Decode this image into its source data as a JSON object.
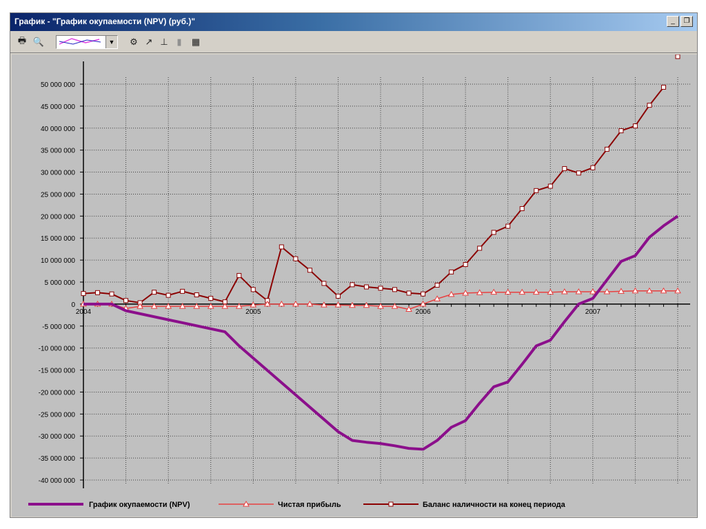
{
  "window": {
    "title": "График - \"График окупаемости (NPV) (руб.)\""
  },
  "toolbar": {
    "icons": [
      "printer-icon",
      "print-preview-icon",
      "chart-type-combo",
      "chart-properties-icon",
      "axis-icon",
      "gridlines-icon",
      "3d-icon",
      "table-icon"
    ]
  },
  "colors": {
    "npv": "#8b0f8b",
    "profit": "#e84040",
    "balance": "#8b0000",
    "plot_background": "#c0c0c0"
  },
  "chart_data": {
    "type": "line",
    "title": "",
    "xlabel": "",
    "ylabel": "",
    "ylim": [
      -40000000,
      50000000
    ],
    "ytick_values": [
      50000000,
      45000000,
      40000000,
      35000000,
      30000000,
      25000000,
      20000000,
      15000000,
      10000000,
      5000000,
      0,
      -5000000,
      -10000000,
      -15000000,
      -20000000,
      -25000000,
      -30000000,
      -35000000,
      -40000000
    ],
    "ytick_labels": [
      "50 000 000",
      "45 000 000",
      "40 000 000",
      "35 000 000",
      "30 000 000",
      "25 000 000",
      "20 000 000",
      "15 000 000",
      "10 000 000",
      "5 000 000",
      "0",
      "-5 000 000",
      "-10 000 000",
      "-15 000 000",
      "-20 000 000",
      "-25 000 000",
      "-30 000 000",
      "-35 000 000",
      "-40 000 000"
    ],
    "x_period_months": 42,
    "year_labels": [
      {
        "label": "2004",
        "month": 0
      },
      {
        "label": "2005",
        "month": 12
      },
      {
        "label": "2006",
        "month": 24
      },
      {
        "label": "2007",
        "month": 36
      }
    ],
    "grid": true,
    "legend_position": "bottom",
    "series": [
      {
        "name": "График окупаемости (NPV)",
        "marker": "none",
        "months": [
          0,
          1,
          2,
          3,
          10,
          11,
          12,
          18,
          19,
          20,
          21,
          22,
          23,
          24,
          25,
          26,
          27,
          28,
          29,
          30,
          31,
          32,
          33,
          34,
          35,
          36,
          37,
          38,
          39,
          40,
          41,
          42
        ],
        "values": [
          0,
          0,
          0,
          -1500000,
          -6300000,
          -9500000,
          -12300000,
          -29000000,
          -31000000,
          -31400000,
          -31700000,
          -32200000,
          -32800000,
          -33000000,
          -31000000,
          -28000000,
          -26500000,
          -22500000,
          -18800000,
          -17700000,
          -13700000,
          -9500000,
          -8200000,
          -4000000,
          0,
          1300000,
          5500000,
          9700000,
          11000000,
          15200000,
          17800000,
          20000000
        ]
      },
      {
        "name": "Чистая прибыль",
        "marker": "triangle",
        "months": [
          0,
          1,
          2,
          3,
          4,
          5,
          6,
          7,
          8,
          9,
          10,
          11,
          12,
          13,
          14,
          15,
          16,
          17,
          18,
          19,
          20,
          21,
          22,
          23,
          24,
          25,
          26,
          27,
          28,
          29,
          30,
          31,
          32,
          33,
          34,
          35,
          36,
          37,
          38,
          39,
          40,
          41,
          42
        ],
        "values": [
          0,
          0,
          0,
          -1000000,
          -500000,
          -500000,
          -500000,
          -500000,
          -500000,
          -500000,
          -500000,
          -500000,
          -200000,
          0,
          0,
          0,
          0,
          -200000,
          -200000,
          -300000,
          -300000,
          -500000,
          -500000,
          -1200000,
          0,
          1200000,
          2200000,
          2500000,
          2600000,
          2700000,
          2700000,
          2700000,
          2700000,
          2700000,
          2800000,
          2800000,
          2800000,
          2800000,
          2900000,
          3000000,
          3000000,
          3000000,
          3000000
        ]
      },
      {
        "name": "Баланс наличности на конец периода",
        "marker": "square",
        "months": [
          0,
          1,
          2,
          3,
          4,
          5,
          6,
          7,
          8,
          9,
          10,
          11,
          12,
          13,
          14,
          15,
          16,
          17,
          18,
          19,
          20,
          21,
          22,
          23,
          24,
          25,
          26,
          27,
          28,
          29,
          30,
          31,
          32,
          33,
          34,
          35,
          36,
          37,
          38,
          39,
          40,
          41,
          42
        ],
        "values": [
          2400000,
          2600000,
          2300000,
          800000,
          300000,
          2700000,
          2000000,
          2900000,
          2100000,
          1300000,
          500000,
          6500000,
          3300000,
          800000,
          13000000,
          10300000,
          7700000,
          4700000,
          1800000,
          4400000,
          3900000,
          3600000,
          3300000,
          2500000,
          2300000,
          4300000,
          7300000,
          9000000,
          12700000,
          16300000,
          17700000,
          21700000,
          25800000,
          26800000,
          30800000,
          29800000,
          31000000,
          35200000,
          39400000,
          40500000,
          45200000,
          49300000
        ]
      }
    ]
  }
}
